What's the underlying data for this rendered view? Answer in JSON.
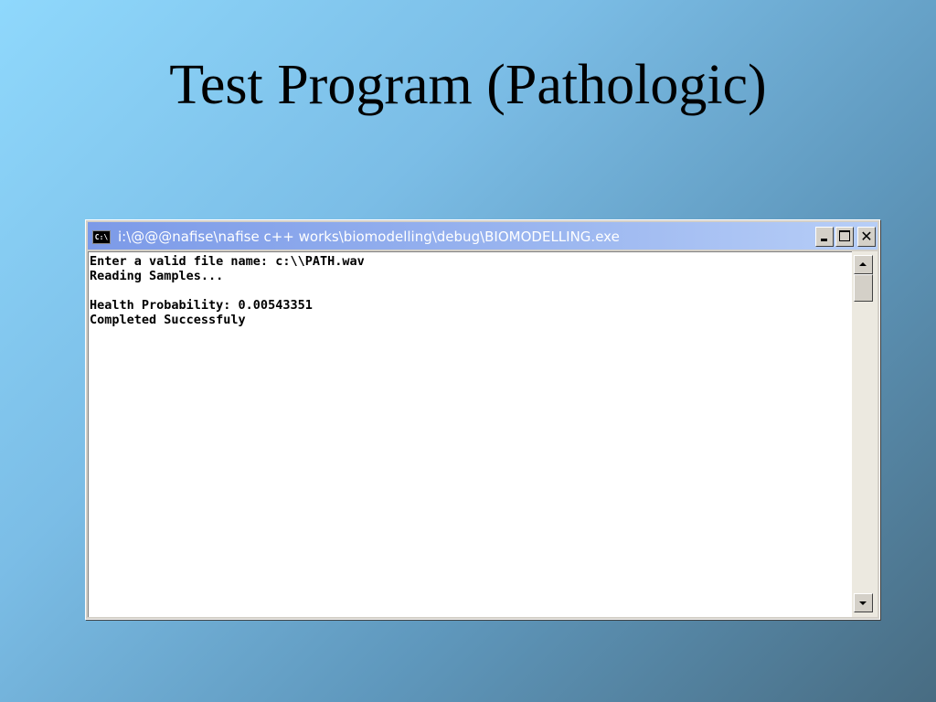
{
  "slide": {
    "title": "Test Program (Pathologic)"
  },
  "window": {
    "icon_label": "C:\\",
    "title": "i:\\@@@nafise\\nafise c++ works\\biomodelling\\debug\\BIOMODELLING.exe",
    "close_label": "✕"
  },
  "console": {
    "lines": [
      "Enter a valid file name: c:\\\\PATH.wav",
      "Reading Samples...",
      "",
      "Health Probability: 0.00543351",
      "Completed Successfuly"
    ]
  },
  "scrollbar": {
    "position": 0.0
  },
  "colors": {
    "title_bar": "#8aa8ec",
    "console_background": "#ffffff",
    "console_text": "#000000"
  }
}
